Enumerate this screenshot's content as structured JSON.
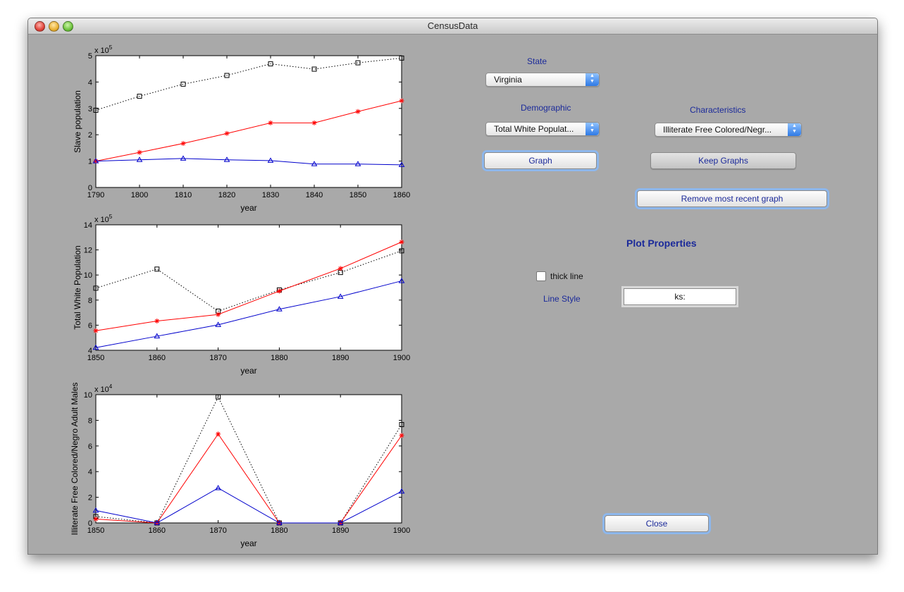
{
  "window": {
    "title": "CensusData"
  },
  "controls": {
    "state_label": "State",
    "state_value": "Virginia",
    "demographic_label": "Demographic",
    "demographic_value": "Total White Populat...",
    "characteristics_label": "Characteristics",
    "characteristics_value": "Illiterate Free Colored/Negr...",
    "graph_button": "Graph",
    "keep_graphs_button": "Keep Graphs",
    "remove_button": "Remove most recent graph",
    "plot_properties_label": "Plot Properties",
    "thick_line_label": "thick line",
    "line_style_label": "Line Style",
    "line_style_value": "ks:",
    "close_button": "Close"
  },
  "chart_data": [
    {
      "type": "line",
      "xlabel": "year",
      "ylabel": "Slave population",
      "exponent_label": "x 10",
      "exponent_power": "5",
      "xlim": [
        1790,
        1860
      ],
      "ylim": [
        0,
        5
      ],
      "xticks": [
        1790,
        1800,
        1810,
        1820,
        1830,
        1840,
        1850,
        1860
      ],
      "yticks": [
        0,
        1,
        2,
        3,
        4,
        5
      ],
      "x": [
        1790,
        1800,
        1810,
        1820,
        1830,
        1840,
        1850,
        1860
      ],
      "series": [
        {
          "color": "#000000",
          "style": "dotted",
          "marker": "square",
          "values": [
            2.93,
            3.46,
            3.92,
            4.25,
            4.69,
            4.49,
            4.73,
            4.91
          ]
        },
        {
          "color": "#ff0000",
          "style": "solid",
          "marker": "star",
          "values": [
            1.0,
            1.33,
            1.67,
            2.05,
            2.45,
            2.45,
            2.88,
            3.29
          ]
        },
        {
          "color": "#0000cc",
          "style": "solid",
          "marker": "triangle",
          "values": [
            1.0,
            1.05,
            1.1,
            1.05,
            1.02,
            0.89,
            0.89,
            0.86
          ]
        }
      ]
    },
    {
      "type": "line",
      "xlabel": "year",
      "ylabel": "Total White Population",
      "exponent_label": "x 10",
      "exponent_power": "5",
      "xlim": [
        1850,
        1900
      ],
      "ylim": [
        4,
        14
      ],
      "xticks": [
        1850,
        1860,
        1870,
        1880,
        1890,
        1900
      ],
      "yticks": [
        4,
        6,
        8,
        10,
        12,
        14
      ],
      "x": [
        1850,
        1860,
        1870,
        1880,
        1890,
        1900
      ],
      "series": [
        {
          "color": "#000000",
          "style": "dotted",
          "marker": "square",
          "values": [
            8.95,
            10.47,
            7.12,
            8.81,
            10.2,
            11.93
          ]
        },
        {
          "color": "#ff0000",
          "style": "solid",
          "marker": "star",
          "values": [
            5.56,
            6.33,
            6.85,
            8.72,
            10.52,
            12.63
          ]
        },
        {
          "color": "#0000cc",
          "style": "solid",
          "marker": "triangle",
          "values": [
            4.21,
            5.12,
            6.03,
            7.27,
            8.28,
            9.53
          ]
        }
      ]
    },
    {
      "type": "line",
      "xlabel": "year",
      "ylabel": "Illiterate Free Colored/Negro Adult Males",
      "exponent_label": "x 10",
      "exponent_power": "4",
      "xlim": [
        1850,
        1900
      ],
      "ylim": [
        0,
        10
      ],
      "xticks": [
        1850,
        1860,
        1870,
        1880,
        1890,
        1900
      ],
      "yticks": [
        0,
        2,
        4,
        6,
        8,
        10
      ],
      "x": [
        1850,
        1860,
        1870,
        1880,
        1890,
        1900
      ],
      "series": [
        {
          "color": "#000000",
          "style": "dotted",
          "marker": "square",
          "values": [
            0.5,
            0.0,
            9.82,
            0.0,
            0.0,
            7.67
          ]
        },
        {
          "color": "#ff0000",
          "style": "solid",
          "marker": "star",
          "values": [
            0.3,
            0.0,
            6.93,
            0.0,
            0.0,
            6.82
          ]
        },
        {
          "color": "#0000cc",
          "style": "solid",
          "marker": "triangle",
          "values": [
            0.97,
            0.0,
            2.72,
            0.0,
            0.0,
            2.46
          ]
        }
      ]
    }
  ]
}
